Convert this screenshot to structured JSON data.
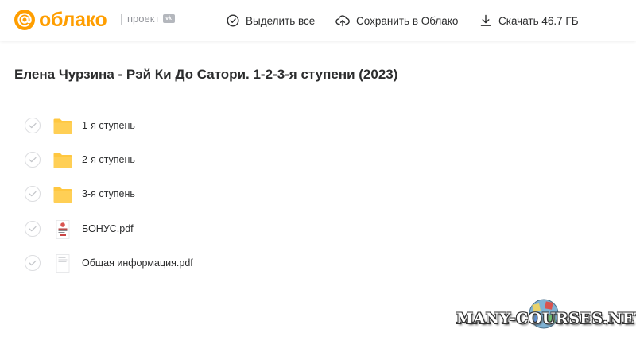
{
  "header": {
    "logo_text": "облако",
    "project_label": "проект",
    "vk_badge": "vk",
    "select_all_label": "Выделить все",
    "save_label": "Сохранить в Облако",
    "download_label": "Скачать 46.7 ГБ"
  },
  "page": {
    "title": "Елена Чурзина - Рэй Ки До Сатори. 1-2-3-я ступени (2023)"
  },
  "files": [
    {
      "name": "1-я ступень",
      "type": "folder",
      "icon": "folder-icon"
    },
    {
      "name": "2-я ступень",
      "type": "folder",
      "icon": "folder-icon"
    },
    {
      "name": "3-я ступень",
      "type": "folder",
      "icon": "folder-icon"
    },
    {
      "name": "БОНУС.pdf",
      "type": "pdf",
      "icon": "pdf-thumbnail-icon"
    },
    {
      "name": "Общая информация.pdf",
      "type": "pdf",
      "icon": "pdf-document-icon"
    }
  ],
  "watermark": {
    "text": "MANY-COURSES.NET"
  },
  "colors": {
    "brand": "#ff9e00",
    "folder": "#ffc740",
    "text": "#2c2d2e",
    "muted": "#919399"
  }
}
